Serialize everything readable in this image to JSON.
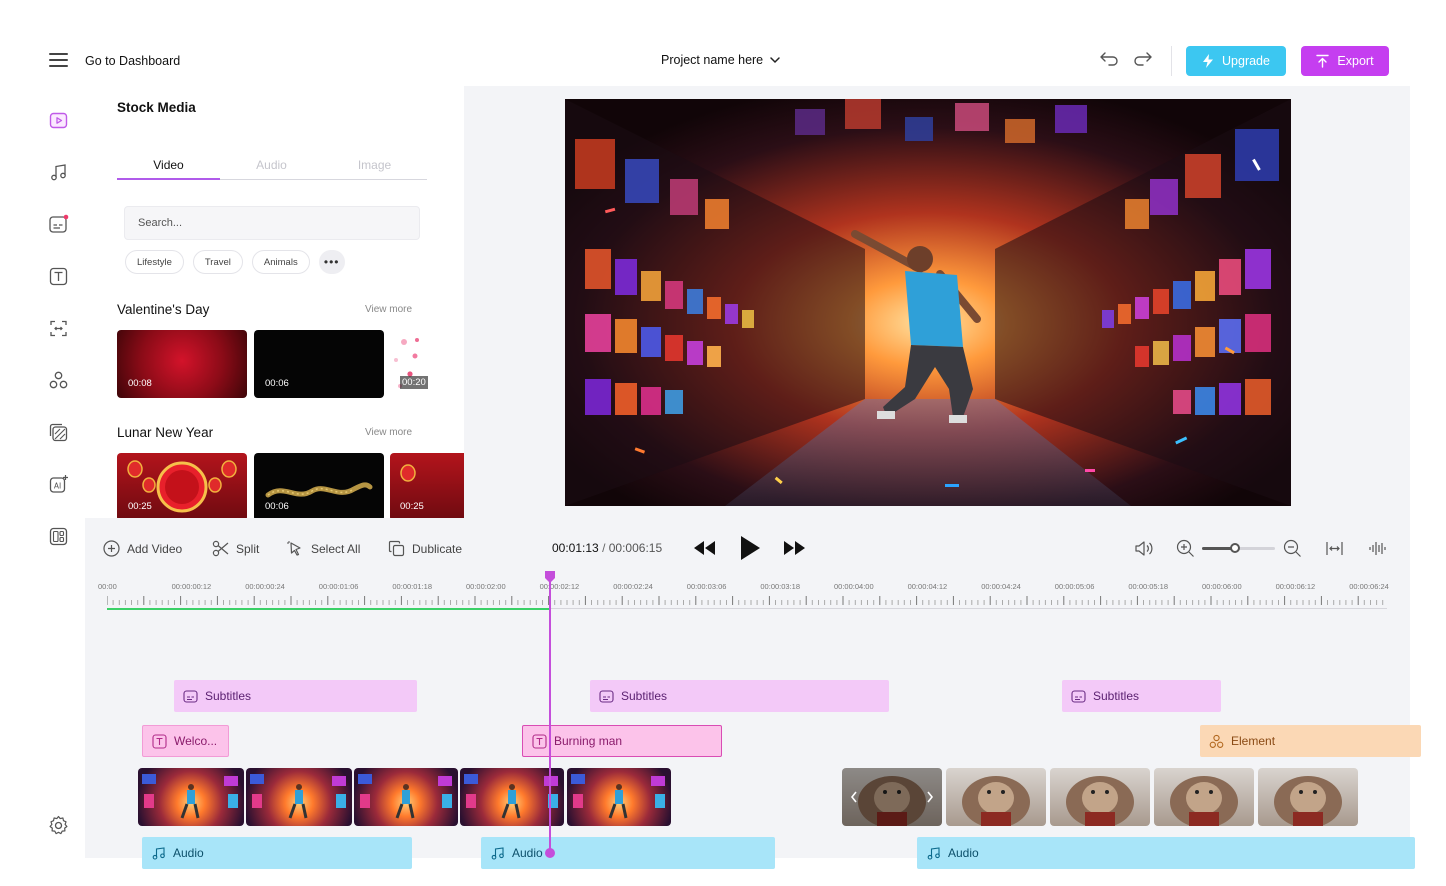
{
  "header": {
    "dashboard_label": "Go to Dashboard",
    "project_name": "Project name here",
    "upgrade_label": "Upgrade",
    "export_label": "Export"
  },
  "colors": {
    "upgrade": "#3cc7f1",
    "export": "#c53ef0",
    "accent": "#b05bea",
    "playhead": "#c44edb"
  },
  "sidebar": {
    "items": [
      {
        "icon": "video-icon",
        "active": true
      },
      {
        "icon": "music-icon"
      },
      {
        "icon": "subtitles-icon",
        "badge": true
      },
      {
        "icon": "text-icon"
      },
      {
        "icon": "transitions-icon"
      },
      {
        "icon": "elements-icon"
      },
      {
        "icon": "overlay-icon"
      },
      {
        "icon": "ai-icon"
      },
      {
        "icon": "templates-icon"
      }
    ],
    "footer_icon": "settings-icon"
  },
  "stock_media": {
    "title": "Stock Media",
    "tabs": [
      {
        "label": "Video",
        "active": true
      },
      {
        "label": "Audio"
      },
      {
        "label": "Image"
      }
    ],
    "search_placeholder": "Search...",
    "chips": [
      "Lifestyle",
      "Travel",
      "Animals"
    ],
    "sections": [
      {
        "title": "Valentine's Day",
        "view_more": "View more",
        "items": [
          {
            "duration": "00:08"
          },
          {
            "duration": "00:06"
          },
          {
            "duration": "00:20"
          }
        ]
      },
      {
        "title": "Lunar New Year",
        "view_more": "View more",
        "items": [
          {
            "duration": "00:25"
          },
          {
            "duration": "00:06"
          },
          {
            "duration": "00:25"
          }
        ]
      }
    ]
  },
  "timeline": {
    "tools": {
      "add_video": "Add Video",
      "split": "Split",
      "select_all": "Select All",
      "duplicate": "Dublicate"
    },
    "current_time": "00:01:13",
    "separator": "/",
    "total_time": "00:006:15",
    "zoom_level": 0.45,
    "ruler_labels": [
      "00:00",
      "00:00:00:12",
      "00:00:00:24",
      "00:00:01:06",
      "00:00:01:18",
      "00:00:02:00",
      "00:00:02:12",
      "00:00:02:24",
      "00:00:03:06",
      "00:00:03:18",
      "00:00:04:00",
      "00:00:04:12",
      "00:00:04:24",
      "00:00:05:06",
      "00:00:05:18",
      "00:00:06:00",
      "00:00:06:12",
      "00:00:06:24"
    ],
    "tracks": {
      "subtitles": [
        "Subtitles",
        "Subtitles",
        "Subtitles"
      ],
      "text": [
        "Welco...",
        "Burning man"
      ],
      "element": "Element",
      "audio": [
        "Audio",
        "Audio",
        "Audio"
      ]
    }
  }
}
